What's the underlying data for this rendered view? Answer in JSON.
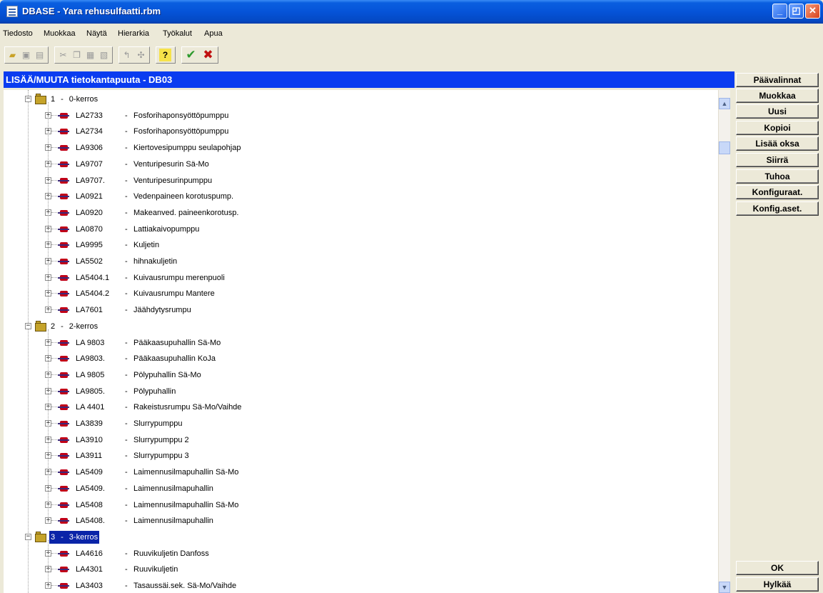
{
  "window": {
    "title": "DBASE - Yara rehusulfaatti.rbm",
    "controls": {
      "minimize": "_",
      "maximize": "◰",
      "close": "✕"
    }
  },
  "menu": [
    "Tiedosto",
    "Muokkaa",
    "Näytä",
    "Hierarkia",
    "Työkalut",
    "Apua"
  ],
  "toolbar": {
    "icons": [
      "open-folder-icon",
      "save-icon",
      "print-icon",
      "cut-icon",
      "copy-icon",
      "paste-icon",
      "paste-special-icon",
      "undo-icon",
      "tree-icon",
      "help-icon",
      "accept-icon",
      "cancel-icon"
    ],
    "help_glyph": "?",
    "accept_glyph": "✔",
    "cancel_glyph": "✖",
    "accept_color": "#2e9a2e",
    "cancel_color": "#c01010"
  },
  "panel": {
    "title": "LISÄÄ/MUUTA tietokantapuuta - DB03"
  },
  "tree": {
    "groups": [
      {
        "number": "1",
        "sep": "-",
        "label": "0-kerros",
        "selected": false,
        "items": [
          {
            "code": "LA2733",
            "name": "Fosforihaponsyöttöpumppu"
          },
          {
            "code": "LA2734",
            "name": "Fosforihaponsyöttöpumppu"
          },
          {
            "code": "LA9306",
            "name": "Kiertovesipumppu seulapohjap"
          },
          {
            "code": "LA9707",
            "name": "Venturipesurin Sä-Mo"
          },
          {
            "code": "LA9707.",
            "name": "Venturipesurinpumppu"
          },
          {
            "code": "LA0921",
            "name": "Vedenpaineen korotuspump."
          },
          {
            "code": "LA0920",
            "name": "Makeanved. paineenkorotusp."
          },
          {
            "code": "LA0870",
            "name": "Lattiakaivopumppu"
          },
          {
            "code": "LA9995",
            "name": "Kuljetin"
          },
          {
            "code": "LA5502",
            "name": "hihnakuljetin"
          },
          {
            "code": "LA5404.1",
            "name": "Kuivausrumpu merenpuoli"
          },
          {
            "code": "LA5404.2",
            "name": "Kuivausrumpu Mantere"
          },
          {
            "code": "LA7601",
            "name": "Jäähdytysrumpu"
          }
        ]
      },
      {
        "number": "2",
        "sep": "-",
        "label": "2-kerros",
        "selected": false,
        "items": [
          {
            "code": "LA 9803",
            "name": "Pääkaasupuhallin Sä-Mo"
          },
          {
            "code": "LA9803.",
            "name": "Pääkaasupuhallin KoJa"
          },
          {
            "code": "LA 9805",
            "name": "Pölypuhallin Sä-Mo"
          },
          {
            "code": "LA9805.",
            "name": "Pölypuhallin"
          },
          {
            "code": "LA 4401",
            "name": "Rakeistusrumpu Sä-Mo/Vaihde"
          },
          {
            "code": "LA3839",
            "name": "Slurrypumppu"
          },
          {
            "code": "LA3910",
            "name": "Slurrypumppu 2"
          },
          {
            "code": "LA3911",
            "name": "Slurrypumppu 3"
          },
          {
            "code": "LA5409",
            "name": "Laimennusilmapuhallin Sä-Mo"
          },
          {
            "code": "LA5409.",
            "name": "Laimennusilmapuhallin"
          },
          {
            "code": "LA5408",
            "name": "Laimennusilmapuhallin Sä-Mo"
          },
          {
            "code": "LA5408.",
            "name": "Laimennusilmapuhallin"
          }
        ]
      },
      {
        "number": "3",
        "sep": "-",
        "label": "3-kerros",
        "selected": true,
        "items": [
          {
            "code": "LA4616",
            "name": "Ruuvikuljetin Danfoss"
          },
          {
            "code": "LA4301",
            "name": "Ruuvikuljetin"
          },
          {
            "code": "LA3403",
            "name": "Tasaussäi.sek. Sä-Mo/Vaihde"
          }
        ]
      }
    ],
    "item_separator": "-",
    "expand_glyph": "+",
    "collapse_glyph": "−"
  },
  "scrollbar": {
    "up": "▲",
    "down": "▼"
  },
  "sidebar": {
    "buttons": [
      "Päävalinnat",
      "Muokkaa",
      "Uusi",
      "Kopioi",
      "Lisää oksa",
      "Siirrä",
      "Tuhoa",
      "Konfiguraat.",
      "Konfig.aset."
    ],
    "ok": "OK",
    "cancel": "Hylkää"
  }
}
